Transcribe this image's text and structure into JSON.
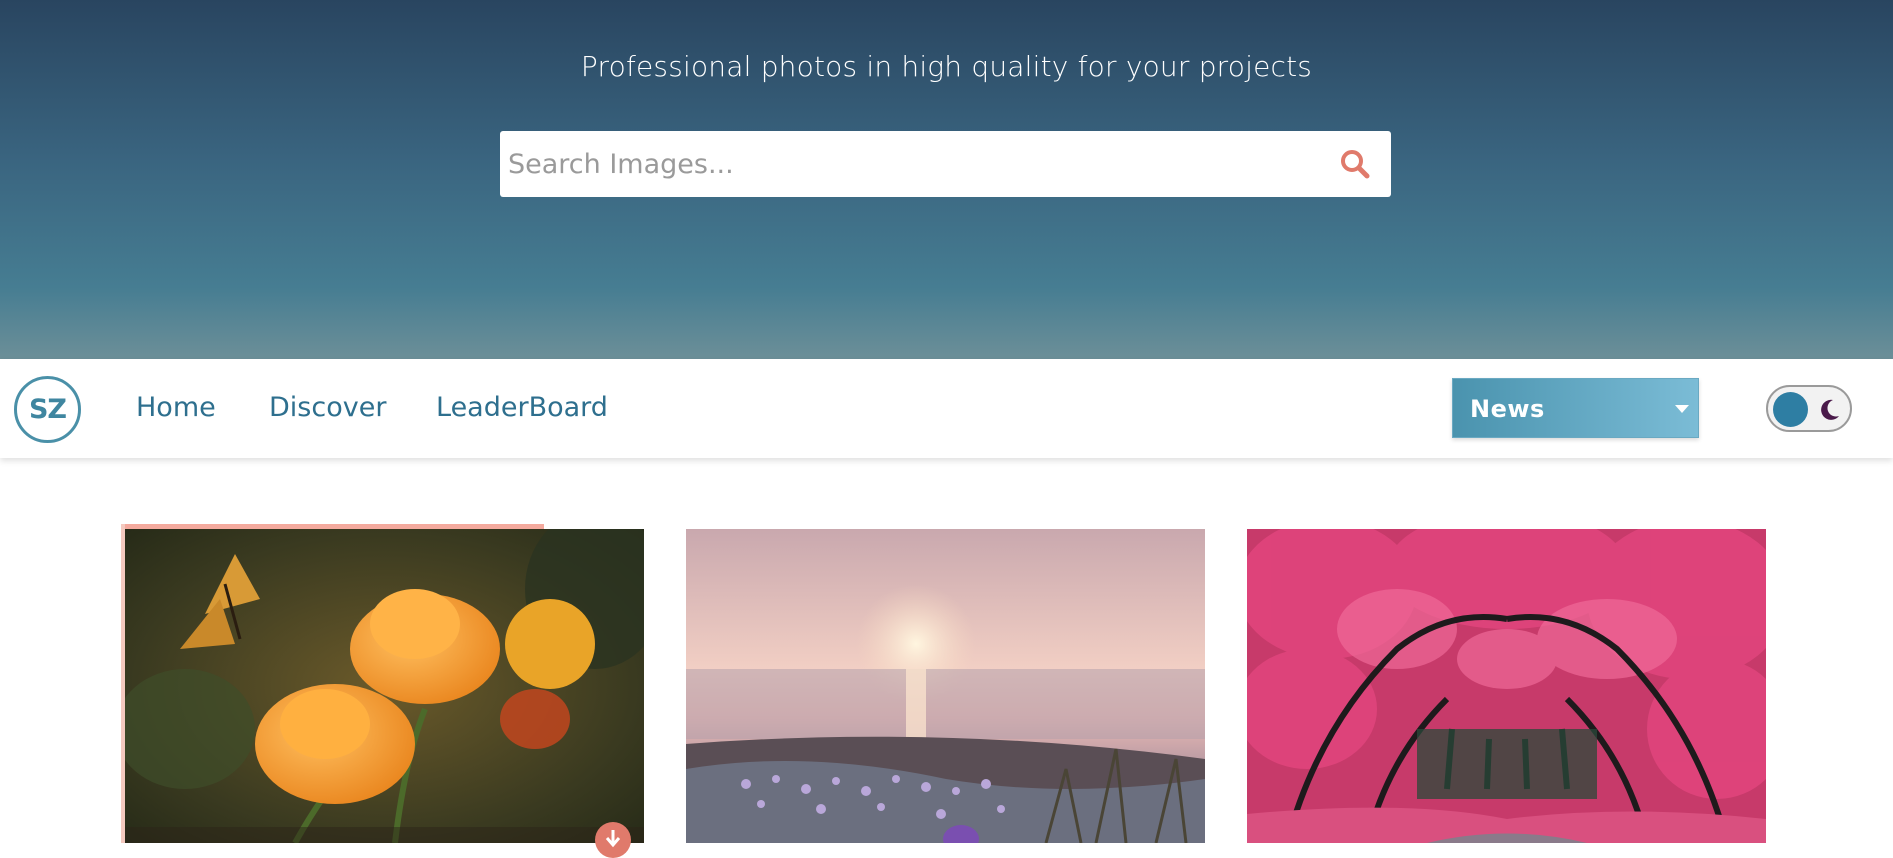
{
  "hero": {
    "tagline": "Professional photos in high quality for your projects"
  },
  "search": {
    "placeholder": "Search Images...",
    "value": "",
    "icon": "search-icon"
  },
  "navbar": {
    "logo_text": "SZ",
    "links": [
      {
        "label": "Home"
      },
      {
        "label": "Discover"
      },
      {
        "label": "LeaderBoard"
      }
    ],
    "category": {
      "selected": "News"
    },
    "theme_toggle": {
      "icon": "moon-icon",
      "mode": "light"
    }
  },
  "gallery": {
    "cards": [
      {
        "subject": "orange flowers with butterfly",
        "has_download": true
      },
      {
        "subject": "sunset over sea with purple flowers"
      },
      {
        "subject": "pink blossom tree tunnel"
      }
    ]
  },
  "colors": {
    "accent": "#e07a6b",
    "nav_text": "#2e6f8e",
    "hero_top": "#294560",
    "hero_bottom": "#6c8f98"
  }
}
